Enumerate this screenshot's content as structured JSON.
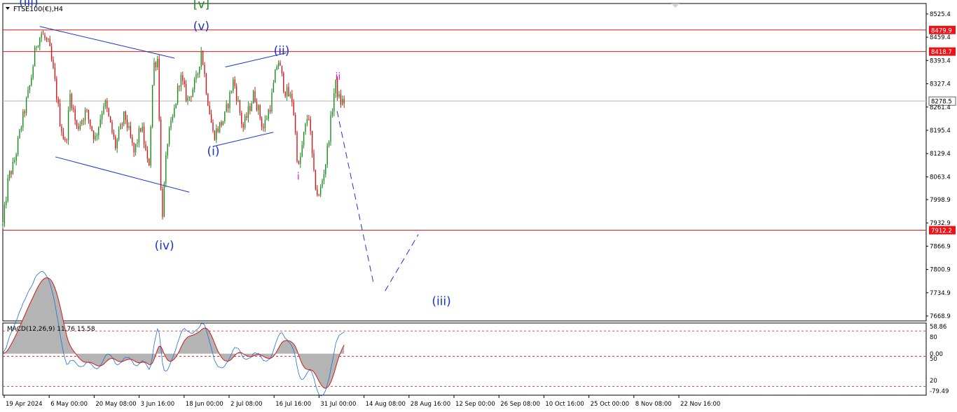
{
  "header": {
    "symbol_label": "FTSE100(€),H4"
  },
  "macd_label": "MACD(12,26,9) 11.76 15.58",
  "price_levels": [
    {
      "value": 8479.9,
      "label": "8479.9",
      "color": "#e8151b"
    },
    {
      "value": 8418.7,
      "label": "8418.7",
      "color": "#e8151b"
    },
    {
      "value": 7912.2,
      "label": "7912.2",
      "color": "#e8151b"
    }
  ],
  "current_price": {
    "value": 8278.5,
    "label": "8278.5"
  },
  "wave_labels": [
    {
      "text": "(iii)",
      "color": "#1a35c8",
      "size": "big",
      "t": 0.028,
      "price": 8548
    },
    {
      "text": "[v]",
      "color": "#1e8a1e",
      "size": "big",
      "t": 0.215,
      "price": 8542
    },
    {
      "text": "(v)",
      "color": "#1a35c8",
      "size": "big",
      "t": 0.215,
      "price": 8480
    },
    {
      "text": "(ii)",
      "color": "#1a35c8",
      "size": "big",
      "t": 0.302,
      "price": 8410
    },
    {
      "text": "(i)",
      "color": "#1a35c8",
      "size": "big",
      "t": 0.228,
      "price": 8125
    },
    {
      "text": "(iv)",
      "color": "#1a35c8",
      "size": "big",
      "t": 0.175,
      "price": 7858
    },
    {
      "text": "ii",
      "color": "#e020e0",
      "size": "mid",
      "t": 0.363,
      "price": 8338
    },
    {
      "text": "i",
      "color": "#e020e0",
      "size": "mid",
      "t": 0.32,
      "price": 8055
    },
    {
      "text": "(iii)",
      "color": "#1a35c8",
      "size": "big",
      "t": 0.475,
      "price": 7700
    }
  ],
  "chart_data": {
    "type": "candlestick",
    "symbol": "FTSE100(€)",
    "timeframe": "H4",
    "y_axis_ticks": [
      8525.4,
      8459.4,
      8393.4,
      8327.4,
      8261.4,
      8195.4,
      8129.4,
      8063.4,
      7998.9,
      7932.9,
      7866.9,
      7800.9,
      7734.9,
      7668.9
    ],
    "ylim": [
      7655,
      8555
    ],
    "x_axis_ticks": [
      "19 Apr 2024",
      "6 May 00:00",
      "20 May 08:00",
      "3 Jun 16:00",
      "18 Jun 00:00",
      "2 Jul 08:00",
      "16 Jul 16:00",
      "31 Jul 00:00",
      "14 Aug 08:00",
      "28 Aug 16:00",
      "12 Sep 00:00",
      "26 Sep 08:00",
      "10 Oct 16:00",
      "25 Oct 00:00",
      "8 Nov 08:00",
      "22 Nov 16:00"
    ],
    "up_color": "#1e8a1e",
    "down_color": "#d01818",
    "price_path": [
      [
        0.0,
        7925
      ],
      [
        0.006,
        8060
      ],
      [
        0.012,
        8100
      ],
      [
        0.02,
        8210
      ],
      [
        0.03,
        8330
      ],
      [
        0.036,
        8440
      ],
      [
        0.042,
        8470
      ],
      [
        0.05,
        8435
      ],
      [
        0.056,
        8340
      ],
      [
        0.062,
        8220
      ],
      [
        0.068,
        8150
      ],
      [
        0.073,
        8300
      ],
      [
        0.08,
        8200
      ],
      [
        0.09,
        8250
      ],
      [
        0.1,
        8170
      ],
      [
        0.11,
        8280
      ],
      [
        0.122,
        8150
      ],
      [
        0.132,
        8240
      ],
      [
        0.142,
        8130
      ],
      [
        0.15,
        8210
      ],
      [
        0.158,
        8080
      ],
      [
        0.163,
        8380
      ],
      [
        0.168,
        8400
      ],
      [
        0.172,
        7925
      ],
      [
        0.178,
        8160
      ],
      [
        0.185,
        8240
      ],
      [
        0.192,
        8350
      ],
      [
        0.2,
        8280
      ],
      [
        0.21,
        8340
      ],
      [
        0.215,
        8425
      ],
      [
        0.221,
        8300
      ],
      [
        0.228,
        8180
      ],
      [
        0.24,
        8230
      ],
      [
        0.25,
        8340
      ],
      [
        0.26,
        8200
      ],
      [
        0.272,
        8300
      ],
      [
        0.282,
        8200
      ],
      [
        0.29,
        8270
      ],
      [
        0.298,
        8400
      ],
      [
        0.305,
        8310
      ],
      [
        0.314,
        8280
      ],
      [
        0.32,
        8080
      ],
      [
        0.326,
        8180
      ],
      [
        0.331,
        8250
      ],
      [
        0.337,
        8060
      ],
      [
        0.342,
        8000
      ],
      [
        0.35,
        8110
      ],
      [
        0.356,
        8240
      ],
      [
        0.36,
        8330
      ],
      [
        0.365,
        8275
      ],
      [
        0.37,
        8278
      ]
    ],
    "trend_lines": [
      {
        "points": [
          [
            0.04,
            8490
          ],
          [
            0.186,
            8400
          ]
        ],
        "dashed": false,
        "color": "#1a35c8"
      },
      {
        "points": [
          [
            0.057,
            8120
          ],
          [
            0.202,
            8020
          ]
        ],
        "dashed": false,
        "color": "#1a35c8"
      },
      {
        "points": [
          [
            0.241,
            8375
          ],
          [
            0.307,
            8415
          ]
        ],
        "dashed": false,
        "color": "#1a35c8"
      },
      {
        "points": [
          [
            0.228,
            8150
          ],
          [
            0.293,
            8190
          ]
        ],
        "dashed": false,
        "color": "#1a35c8"
      },
      {
        "points": [
          [
            0.362,
            8250
          ],
          [
            0.402,
            7755
          ]
        ],
        "dashed": true,
        "color": "#1a35c8"
      },
      {
        "points": [
          [
            0.414,
            7740
          ],
          [
            0.45,
            7900
          ]
        ],
        "dashed": true,
        "color": "#1a35c8"
      }
    ],
    "macd": {
      "label": "MACD(12,26,9) 11.76 15.58",
      "ticks": [
        "58.86",
        "80",
        "0.00",
        "50",
        "20",
        "-79.49"
      ],
      "levels_dashed": [
        80,
        50,
        20
      ],
      "line_color": "#1f6fd6",
      "signal_color": "#d01818",
      "hist_color": "#b4b4b4"
    }
  }
}
